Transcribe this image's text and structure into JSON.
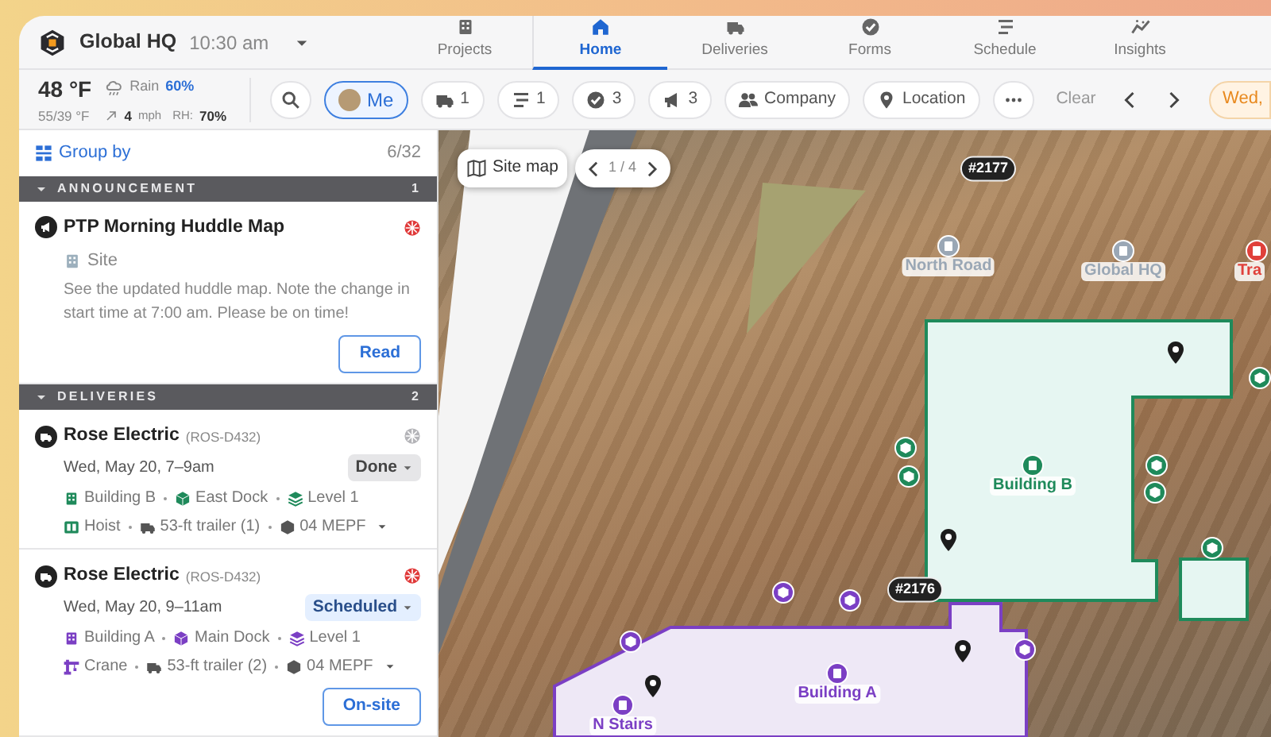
{
  "header": {
    "org_name": "Global HQ",
    "time": "10:30 am"
  },
  "nav_tabs": [
    {
      "label": "Projects",
      "selected": false
    },
    {
      "label": "Home",
      "selected": true
    },
    {
      "label": "Deliveries",
      "selected": false
    },
    {
      "label": "Forms",
      "selected": false
    },
    {
      "label": "Schedule",
      "selected": false
    },
    {
      "label": "Insights",
      "selected": false
    }
  ],
  "weather": {
    "temperature": "48 °F",
    "condition": "Rain",
    "precip_chance": "60%",
    "range": "55/39 °F",
    "wind_speed": "4",
    "wind_unit": "mph",
    "humidity_label": "RH:",
    "humidity": "70%"
  },
  "filters": [
    {
      "kind": "search",
      "selected": false
    },
    {
      "kind": "person",
      "label": "Me",
      "selected": true
    },
    {
      "kind": "truck",
      "label": "1",
      "selected": false
    },
    {
      "kind": "schedule",
      "label": "1",
      "selected": false
    },
    {
      "kind": "check",
      "label": "3",
      "selected": false
    },
    {
      "kind": "megaphone",
      "label": "3",
      "selected": false
    },
    {
      "kind": "people",
      "label": "Company",
      "selected": false
    },
    {
      "kind": "pin",
      "label": "Location",
      "selected": false
    },
    {
      "kind": "more",
      "selected": false
    }
  ],
  "clear_label": "Clear",
  "date_chip": "Wed,",
  "feed": {
    "group_by": "Group by",
    "count": "6/32",
    "sections": [
      {
        "title": "ANNOUNCEMENT",
        "count": "1",
        "expanded": true,
        "items": [
          {
            "kind": "announcement",
            "title": "PTP Morning Huddle Map",
            "color": "#e03a3a",
            "scope": "Site",
            "body": "See the updated huddle map. Note the change in start time at 7:00 am. Please be on time!",
            "action": "Read"
          }
        ]
      },
      {
        "title": "DELIVERIES",
        "count": "2",
        "expanded": true,
        "items": [
          {
            "kind": "delivery",
            "title": "Rose Electric",
            "code": "(ROS-D432)",
            "color": "#b4b4b8",
            "time": "Wed, May 20, 7–9am",
            "status": {
              "label": "Done",
              "kind": "done"
            },
            "tags": [
              [
                {
                  "kind": "building",
                  "label": "Building B",
                  "color": "#1f8a5b"
                },
                {
                  "kind": "cube",
                  "label": "East Dock",
                  "color": "#1f8a5b"
                },
                {
                  "kind": "layers",
                  "label": "Level 1",
                  "color": "#1f8a5b"
                }
              ],
              [
                {
                  "kind": "hoist",
                  "label": "Hoist",
                  "color": "#1f8a5b"
                },
                {
                  "kind": "truck",
                  "label": "53-ft trailer (1)",
                  "color": "#555555"
                },
                {
                  "kind": "box",
                  "label": "04 MEPF",
                  "color": "#555555"
                }
              ]
            ]
          },
          {
            "kind": "delivery",
            "title": "Rose Electric",
            "code": "(ROS-D432)",
            "color": "#e03a3a",
            "time": "Wed, May 20, 9–11am",
            "status": {
              "label": "Scheduled",
              "kind": "scheduled"
            },
            "tags": [
              [
                {
                  "kind": "building",
                  "label": "Building A",
                  "color": "#7b3fc4"
                },
                {
                  "kind": "cube",
                  "label": "Main Dock",
                  "color": "#7b3fc4"
                },
                {
                  "kind": "layers",
                  "label": "Level 1",
                  "color": "#7b3fc4"
                }
              ],
              [
                {
                  "kind": "crane",
                  "label": "Crane",
                  "color": "#7b3fc4"
                },
                {
                  "kind": "truck",
                  "label": "53-ft trailer (2)",
                  "color": "#555555"
                },
                {
                  "kind": "box",
                  "label": "04 MEPF",
                  "color": "#555555"
                }
              ]
            ],
            "action": "On-site"
          }
        ]
      }
    ]
  },
  "map": {
    "site_map_button": "Site map",
    "page_indicator": "1 / 4",
    "labels": [
      {
        "kind": "vehicle",
        "text": "#2177"
      },
      {
        "kind": "place",
        "text": "North Road",
        "color": "#9aa7b5"
      },
      {
        "kind": "place",
        "text": "Global HQ",
        "color": "#9aa7b5"
      },
      {
        "kind": "place",
        "text": "Tra",
        "color": "#e0403a"
      },
      {
        "kind": "place",
        "text": "Building B",
        "color": "#1f8a5b"
      },
      {
        "kind": "vehicle",
        "text": "#2176"
      },
      {
        "kind": "place",
        "text": "Building A",
        "color": "#7b3fc4"
      },
      {
        "kind": "place",
        "text": "N Stairs",
        "color": "#7b3fc4"
      }
    ]
  }
}
